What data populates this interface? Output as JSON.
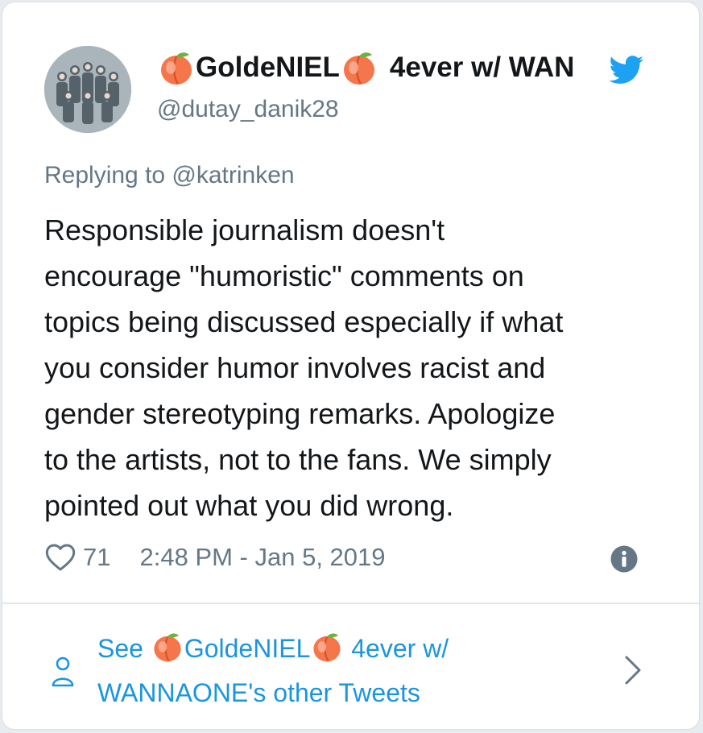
{
  "tweet": {
    "display_name_part1": "GoldeNIEL",
    "display_name_part2": "4ever w/ WAN",
    "display_name_emoji": "peach",
    "handle": "@dutay_danik28",
    "reply_to": "Replying to @katrinken",
    "body_lines": [
      "Responsible journalism doesn't",
      "encourage \"humoristic\" comments on",
      "topics being discussed especially if what",
      "you consider humor involves racist and",
      "gender stereotyping remarks. Apologize",
      "to the artists, not to the fans. We simply",
      "pointed out what you did wrong."
    ],
    "likes": "71",
    "timestamp": "2:48 PM - Jan 5, 2019"
  },
  "footer": {
    "see": "See ",
    "name_part1": "GoldeNIEL",
    "name_part2": " 4ever w/",
    "line2": "WANNAONE's other Tweets"
  },
  "icons": {
    "brand": "twitter-bird-icon",
    "like": "heart-icon",
    "info": "info-icon",
    "profile": "user-icon",
    "more": "chevron-right-icon"
  },
  "colors": {
    "text": "#14171a",
    "secondary": "#657786",
    "link": "#1b95e0",
    "twitter_blue": "#1da1f2",
    "peach": "#f5764a"
  }
}
